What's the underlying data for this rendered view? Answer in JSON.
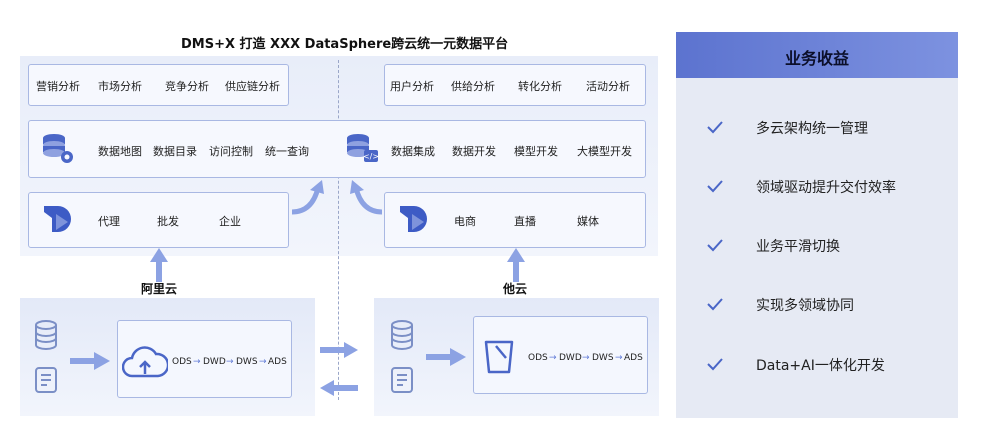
{
  "main_title": "DMS+X 打造 XXX DataSphere跨云统一元数据平台",
  "top_left_apps": [
    "营销分析",
    "市场分析",
    "竞争分析",
    "供应链分析"
  ],
  "top_right_apps": [
    "用户分析",
    "供给分析",
    "转化分析",
    "活动分析"
  ],
  "middle_left": [
    "数据地图",
    "数据目录",
    "访问控制",
    "统一查询"
  ],
  "middle_right": [
    "数据集成",
    "数据开发",
    "模型开发",
    "大模型开发"
  ],
  "scene_left": [
    "代理",
    "批发",
    "企业"
  ],
  "scene_right": [
    "电商",
    "直播",
    "媒体"
  ],
  "cloud_left": "阿里云",
  "cloud_right": "他云",
  "pipeline": [
    "ODS",
    "DWD",
    "DWS",
    "ADS"
  ],
  "benefits_title": "业务收益",
  "benefits": [
    "多云架构统一管理",
    "领域驱动提升交付效率",
    "业务平滑切换",
    "实现多领域协同",
    "Data+AI一体化开发"
  ]
}
